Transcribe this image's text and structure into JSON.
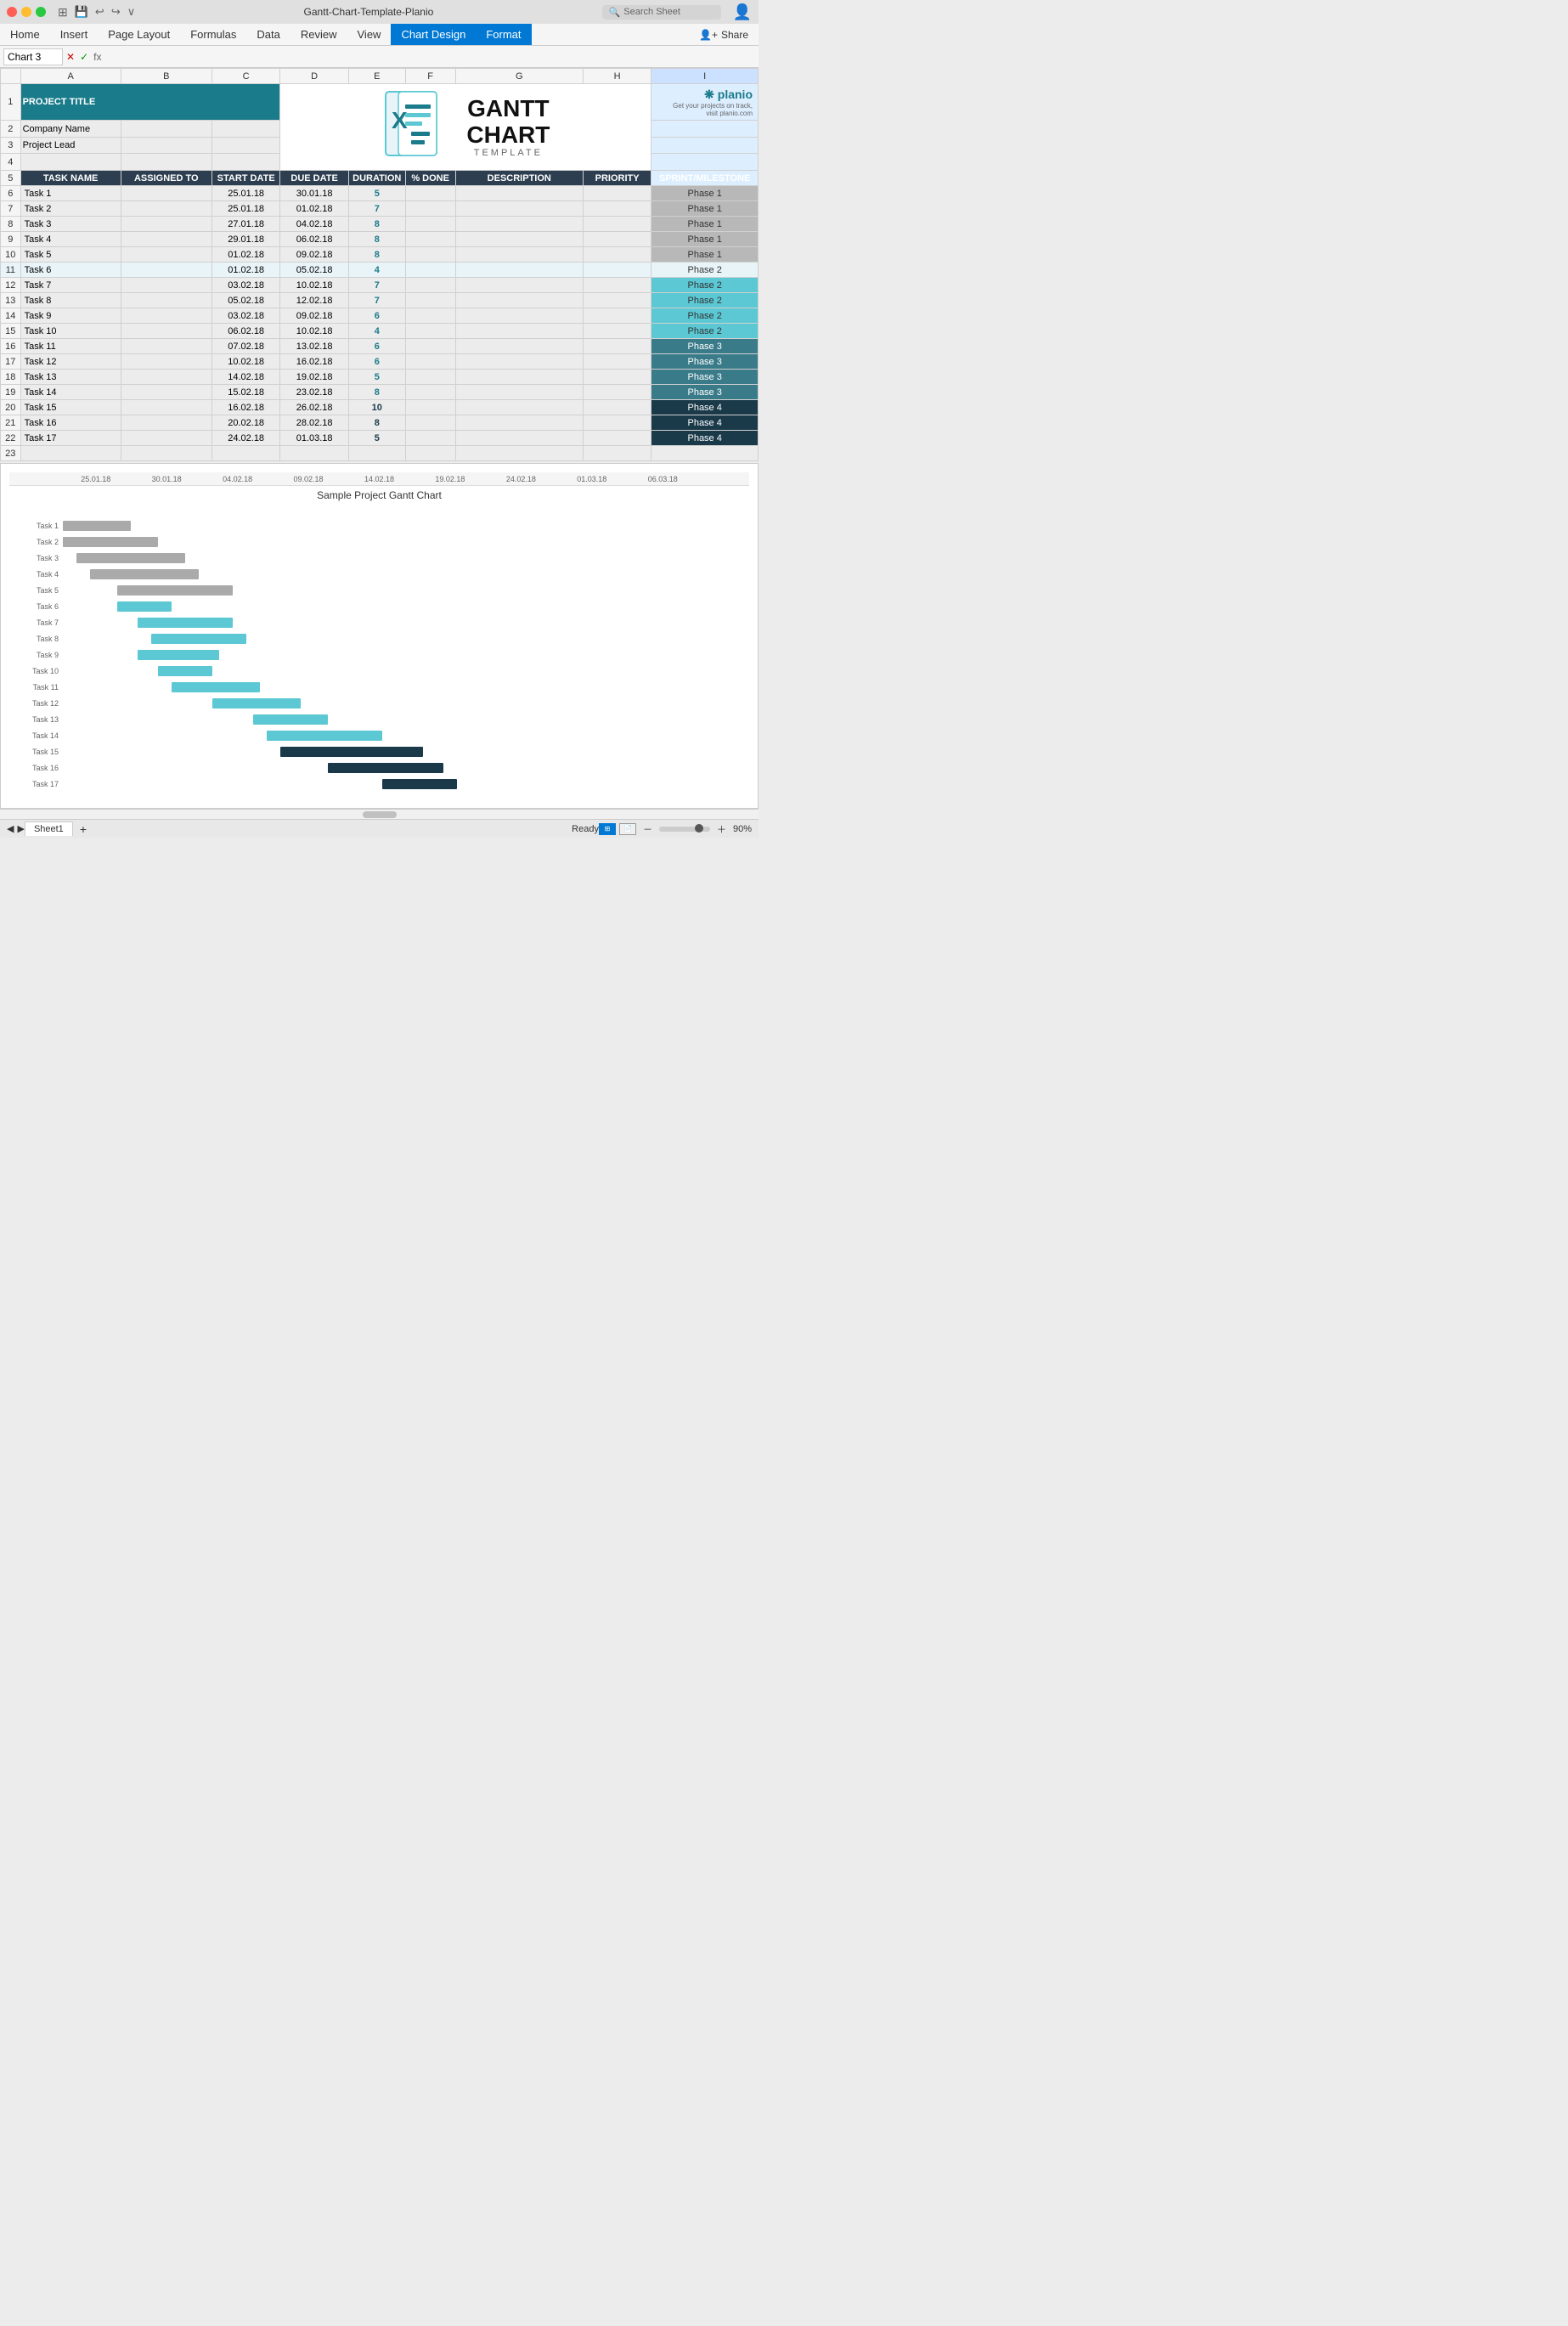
{
  "titlebar": {
    "title": "Gantt-Chart-Template-Planio",
    "search_placeholder": "Search Sheet",
    "icons": [
      "grid",
      "save",
      "undo",
      "redo",
      "more"
    ]
  },
  "menubar": {
    "items": [
      "Home",
      "Insert",
      "Page Layout",
      "Formulas",
      "Data",
      "Review",
      "View",
      "Chart Design",
      "Format"
    ],
    "active_items": [
      "Chart Design",
      "Format"
    ],
    "share_label": "Share"
  },
  "formulabar": {
    "name_box": "Chart 3",
    "formula_content": ""
  },
  "columns": {
    "headers": [
      "",
      "A",
      "B",
      "C",
      "D",
      "E",
      "F",
      "G",
      "H",
      "I"
    ],
    "letters": [
      "A",
      "B",
      "C",
      "D",
      "E",
      "F",
      "G",
      "H",
      "I"
    ]
  },
  "rows": {
    "numbers": [
      1,
      2,
      3,
      4,
      5,
      6,
      7,
      8,
      9,
      10,
      11,
      12,
      13,
      14,
      15,
      16,
      17,
      18,
      19,
      20,
      21,
      22,
      23
    ]
  },
  "project": {
    "title": "PROJECT TITLE",
    "company_label": "Company Name",
    "lead_label": "Project Lead"
  },
  "table_headers": {
    "task_name": "TASK NAME",
    "assigned_to": "ASSIGNED TO",
    "start_date": "START DATE",
    "due_date": "DUE DATE",
    "duration": "DURATION",
    "percent_done": "% DONE",
    "description": "DESCRIPTION",
    "priority": "PRIORITY",
    "sprint": "SPRINT/MILESTONE"
  },
  "tasks": [
    {
      "num": 6,
      "name": "Task 1",
      "assigned": "",
      "start": "25.01.18",
      "due": "30.01.18",
      "duration": "5",
      "pct": "",
      "desc": "",
      "priority": "",
      "phase": "Phase 1",
      "phase_class": "phase1",
      "dur_class": "dur-teal"
    },
    {
      "num": 7,
      "name": "Task 2",
      "assigned": "",
      "start": "25.01.18",
      "due": "01.02.18",
      "duration": "7",
      "pct": "",
      "desc": "",
      "priority": "",
      "phase": "Phase 1",
      "phase_class": "phase1",
      "dur_class": "dur-teal"
    },
    {
      "num": 8,
      "name": "Task 3",
      "assigned": "",
      "start": "27.01.18",
      "due": "04.02.18",
      "duration": "8",
      "pct": "",
      "desc": "",
      "priority": "",
      "phase": "Phase 1",
      "phase_class": "phase1",
      "dur_class": "dur-teal"
    },
    {
      "num": 9,
      "name": "Task 4",
      "assigned": "",
      "start": "29.01.18",
      "due": "06.02.18",
      "duration": "8",
      "pct": "",
      "desc": "",
      "priority": "",
      "phase": "Phase 1",
      "phase_class": "phase1",
      "dur_class": "dur-teal"
    },
    {
      "num": 10,
      "name": "Task 5",
      "assigned": "",
      "start": "01.02.18",
      "due": "09.02.18",
      "duration": "8",
      "pct": "",
      "desc": "",
      "priority": "",
      "phase": "Phase 1",
      "phase_class": "phase1",
      "dur_class": "dur-teal"
    },
    {
      "num": 11,
      "name": "Task 6",
      "assigned": "",
      "start": "01.02.18",
      "due": "05.02.18",
      "duration": "4",
      "pct": "",
      "desc": "",
      "priority": "",
      "phase": "Phase 2",
      "phase_class": "phase2",
      "dur_class": "dur-teal",
      "selected": true
    },
    {
      "num": 12,
      "name": "Task 7",
      "assigned": "",
      "start": "03.02.18",
      "due": "10.02.18",
      "duration": "7",
      "pct": "",
      "desc": "",
      "priority": "",
      "phase": "Phase 2",
      "phase_class": "phase2",
      "dur_class": "dur-teal"
    },
    {
      "num": 13,
      "name": "Task 8",
      "assigned": "",
      "start": "05.02.18",
      "due": "12.02.18",
      "duration": "7",
      "pct": "",
      "desc": "",
      "priority": "",
      "phase": "Phase 2",
      "phase_class": "phase2",
      "dur_class": "dur-teal"
    },
    {
      "num": 14,
      "name": "Task 9",
      "assigned": "",
      "start": "03.02.18",
      "due": "09.02.18",
      "duration": "6",
      "pct": "",
      "desc": "",
      "priority": "",
      "phase": "Phase 2",
      "phase_class": "phase2",
      "dur_class": "dur-teal"
    },
    {
      "num": 15,
      "name": "Task 10",
      "assigned": "",
      "start": "06.02.18",
      "due": "10.02.18",
      "duration": "4",
      "pct": "",
      "desc": "",
      "priority": "",
      "phase": "Phase 2",
      "phase_class": "phase2",
      "dur_class": "dur-teal"
    },
    {
      "num": 16,
      "name": "Task 11",
      "assigned": "",
      "start": "07.02.18",
      "due": "13.02.18",
      "duration": "6",
      "pct": "",
      "desc": "",
      "priority": "",
      "phase": "Phase 3",
      "phase_class": "phase3",
      "dur_class": "dur-teal"
    },
    {
      "num": 17,
      "name": "Task 12",
      "assigned": "",
      "start": "10.02.18",
      "due": "16.02.18",
      "duration": "6",
      "pct": "",
      "desc": "",
      "priority": "",
      "phase": "Phase 3",
      "phase_class": "phase3",
      "dur_class": "dur-teal"
    },
    {
      "num": 18,
      "name": "Task 13",
      "assigned": "",
      "start": "14.02.18",
      "due": "19.02.18",
      "duration": "5",
      "pct": "",
      "desc": "",
      "priority": "",
      "phase": "Phase 3",
      "phase_class": "phase3",
      "dur_class": "dur-teal"
    },
    {
      "num": 19,
      "name": "Task 14",
      "assigned": "",
      "start": "15.02.18",
      "due": "23.02.18",
      "duration": "8",
      "pct": "",
      "desc": "",
      "priority": "",
      "phase": "Phase 3",
      "phase_class": "phase3",
      "dur_class": "dur-teal"
    },
    {
      "num": 20,
      "name": "Task 15",
      "assigned": "",
      "start": "16.02.18",
      "due": "26.02.18",
      "duration": "10",
      "pct": "",
      "desc": "",
      "priority": "",
      "phase": "Phase 4",
      "phase_class": "phase4",
      "dur_class": "dur-dark"
    },
    {
      "num": 21,
      "name": "Task 16",
      "assigned": "",
      "start": "20.02.18",
      "due": "28.02.18",
      "duration": "8",
      "pct": "",
      "desc": "",
      "priority": "",
      "phase": "Phase 4",
      "phase_class": "phase4",
      "dur_class": "dur-dark"
    },
    {
      "num": 22,
      "name": "Task 17",
      "assigned": "",
      "start": "24.02.18",
      "due": "01.03.18",
      "duration": "5",
      "pct": "",
      "desc": "",
      "priority": "",
      "phase": "Phase 4",
      "phase_class": "phase4",
      "dur_class": "dur-dark"
    }
  ],
  "chart": {
    "title": "Sample Project Gantt Chart",
    "dates": [
      "25.01.18",
      "30.01.18",
      "04.02.18",
      "09.02.18",
      "14.02.18",
      "19.02.18",
      "24.02.18",
      "01.03.18",
      "06.03.18"
    ],
    "tasks": [
      {
        "label": "Task 1",
        "start_pct": 0,
        "width_pct": 10,
        "color": "gray"
      },
      {
        "label": "Task 2",
        "start_pct": 0,
        "width_pct": 14,
        "color": "gray"
      },
      {
        "label": "Task 3",
        "start_pct": 2,
        "width_pct": 16,
        "color": "gray"
      },
      {
        "label": "Task 4",
        "start_pct": 4,
        "width_pct": 16,
        "color": "gray"
      },
      {
        "label": "Task 5",
        "start_pct": 8,
        "width_pct": 17,
        "color": "gray"
      },
      {
        "label": "Task 6",
        "start_pct": 8,
        "width_pct": 8,
        "color": "teal"
      },
      {
        "label": "Task 7",
        "start_pct": 11,
        "width_pct": 14,
        "color": "teal"
      },
      {
        "label": "Task 8",
        "start_pct": 13,
        "width_pct": 14,
        "color": "teal"
      },
      {
        "label": "Task 9",
        "start_pct": 11,
        "width_pct": 12,
        "color": "teal"
      },
      {
        "label": "Task 10",
        "start_pct": 14,
        "width_pct": 8,
        "color": "teal"
      },
      {
        "label": "Task 11",
        "start_pct": 16,
        "width_pct": 13,
        "color": "teal"
      },
      {
        "label": "Task 12",
        "start_pct": 22,
        "width_pct": 13,
        "color": "teal"
      },
      {
        "label": "Task 13",
        "start_pct": 28,
        "width_pct": 11,
        "color": "teal"
      },
      {
        "label": "Task 14",
        "start_pct": 30,
        "width_pct": 17,
        "color": "teal"
      },
      {
        "label": "Task 15",
        "start_pct": 32,
        "width_pct": 21,
        "color": "dark"
      },
      {
        "label": "Task 16",
        "start_pct": 39,
        "width_pct": 17,
        "color": "dark"
      },
      {
        "label": "Task 17",
        "start_pct": 47,
        "width_pct": 11,
        "color": "dark"
      }
    ]
  },
  "statusbar": {
    "status": "Ready",
    "sheet_tab": "Sheet1",
    "zoom": "90%"
  }
}
